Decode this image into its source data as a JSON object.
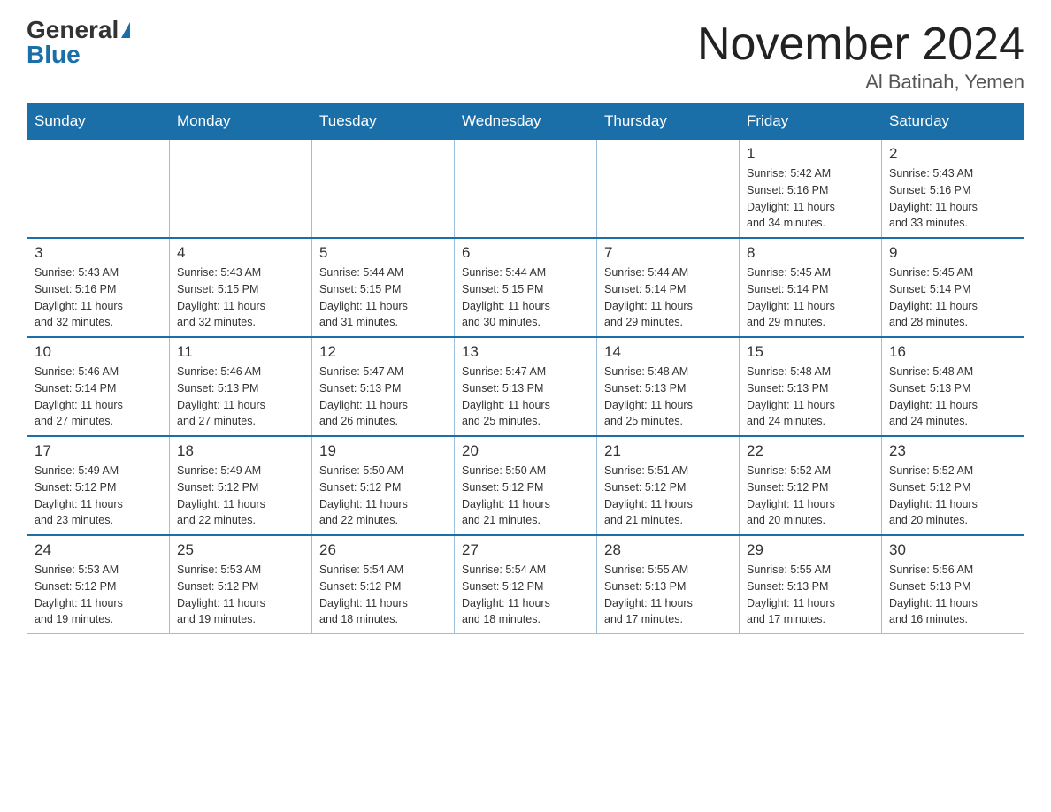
{
  "header": {
    "logo_general": "General",
    "logo_blue": "Blue",
    "month_title": "November 2024",
    "location": "Al Batinah, Yemen"
  },
  "weekdays": [
    "Sunday",
    "Monday",
    "Tuesday",
    "Wednesday",
    "Thursday",
    "Friday",
    "Saturday"
  ],
  "weeks": [
    [
      {
        "day": "",
        "info": ""
      },
      {
        "day": "",
        "info": ""
      },
      {
        "day": "",
        "info": ""
      },
      {
        "day": "",
        "info": ""
      },
      {
        "day": "",
        "info": ""
      },
      {
        "day": "1",
        "info": "Sunrise: 5:42 AM\nSunset: 5:16 PM\nDaylight: 11 hours\nand 34 minutes."
      },
      {
        "day": "2",
        "info": "Sunrise: 5:43 AM\nSunset: 5:16 PM\nDaylight: 11 hours\nand 33 minutes."
      }
    ],
    [
      {
        "day": "3",
        "info": "Sunrise: 5:43 AM\nSunset: 5:16 PM\nDaylight: 11 hours\nand 32 minutes."
      },
      {
        "day": "4",
        "info": "Sunrise: 5:43 AM\nSunset: 5:15 PM\nDaylight: 11 hours\nand 32 minutes."
      },
      {
        "day": "5",
        "info": "Sunrise: 5:44 AM\nSunset: 5:15 PM\nDaylight: 11 hours\nand 31 minutes."
      },
      {
        "day": "6",
        "info": "Sunrise: 5:44 AM\nSunset: 5:15 PM\nDaylight: 11 hours\nand 30 minutes."
      },
      {
        "day": "7",
        "info": "Sunrise: 5:44 AM\nSunset: 5:14 PM\nDaylight: 11 hours\nand 29 minutes."
      },
      {
        "day": "8",
        "info": "Sunrise: 5:45 AM\nSunset: 5:14 PM\nDaylight: 11 hours\nand 29 minutes."
      },
      {
        "day": "9",
        "info": "Sunrise: 5:45 AM\nSunset: 5:14 PM\nDaylight: 11 hours\nand 28 minutes."
      }
    ],
    [
      {
        "day": "10",
        "info": "Sunrise: 5:46 AM\nSunset: 5:14 PM\nDaylight: 11 hours\nand 27 minutes."
      },
      {
        "day": "11",
        "info": "Sunrise: 5:46 AM\nSunset: 5:13 PM\nDaylight: 11 hours\nand 27 minutes."
      },
      {
        "day": "12",
        "info": "Sunrise: 5:47 AM\nSunset: 5:13 PM\nDaylight: 11 hours\nand 26 minutes."
      },
      {
        "day": "13",
        "info": "Sunrise: 5:47 AM\nSunset: 5:13 PM\nDaylight: 11 hours\nand 25 minutes."
      },
      {
        "day": "14",
        "info": "Sunrise: 5:48 AM\nSunset: 5:13 PM\nDaylight: 11 hours\nand 25 minutes."
      },
      {
        "day": "15",
        "info": "Sunrise: 5:48 AM\nSunset: 5:13 PM\nDaylight: 11 hours\nand 24 minutes."
      },
      {
        "day": "16",
        "info": "Sunrise: 5:48 AM\nSunset: 5:13 PM\nDaylight: 11 hours\nand 24 minutes."
      }
    ],
    [
      {
        "day": "17",
        "info": "Sunrise: 5:49 AM\nSunset: 5:12 PM\nDaylight: 11 hours\nand 23 minutes."
      },
      {
        "day": "18",
        "info": "Sunrise: 5:49 AM\nSunset: 5:12 PM\nDaylight: 11 hours\nand 22 minutes."
      },
      {
        "day": "19",
        "info": "Sunrise: 5:50 AM\nSunset: 5:12 PM\nDaylight: 11 hours\nand 22 minutes."
      },
      {
        "day": "20",
        "info": "Sunrise: 5:50 AM\nSunset: 5:12 PM\nDaylight: 11 hours\nand 21 minutes."
      },
      {
        "day": "21",
        "info": "Sunrise: 5:51 AM\nSunset: 5:12 PM\nDaylight: 11 hours\nand 21 minutes."
      },
      {
        "day": "22",
        "info": "Sunrise: 5:52 AM\nSunset: 5:12 PM\nDaylight: 11 hours\nand 20 minutes."
      },
      {
        "day": "23",
        "info": "Sunrise: 5:52 AM\nSunset: 5:12 PM\nDaylight: 11 hours\nand 20 minutes."
      }
    ],
    [
      {
        "day": "24",
        "info": "Sunrise: 5:53 AM\nSunset: 5:12 PM\nDaylight: 11 hours\nand 19 minutes."
      },
      {
        "day": "25",
        "info": "Sunrise: 5:53 AM\nSunset: 5:12 PM\nDaylight: 11 hours\nand 19 minutes."
      },
      {
        "day": "26",
        "info": "Sunrise: 5:54 AM\nSunset: 5:12 PM\nDaylight: 11 hours\nand 18 minutes."
      },
      {
        "day": "27",
        "info": "Sunrise: 5:54 AM\nSunset: 5:12 PM\nDaylight: 11 hours\nand 18 minutes."
      },
      {
        "day": "28",
        "info": "Sunrise: 5:55 AM\nSunset: 5:13 PM\nDaylight: 11 hours\nand 17 minutes."
      },
      {
        "day": "29",
        "info": "Sunrise: 5:55 AM\nSunset: 5:13 PM\nDaylight: 11 hours\nand 17 minutes."
      },
      {
        "day": "30",
        "info": "Sunrise: 5:56 AM\nSunset: 5:13 PM\nDaylight: 11 hours\nand 16 minutes."
      }
    ]
  ]
}
